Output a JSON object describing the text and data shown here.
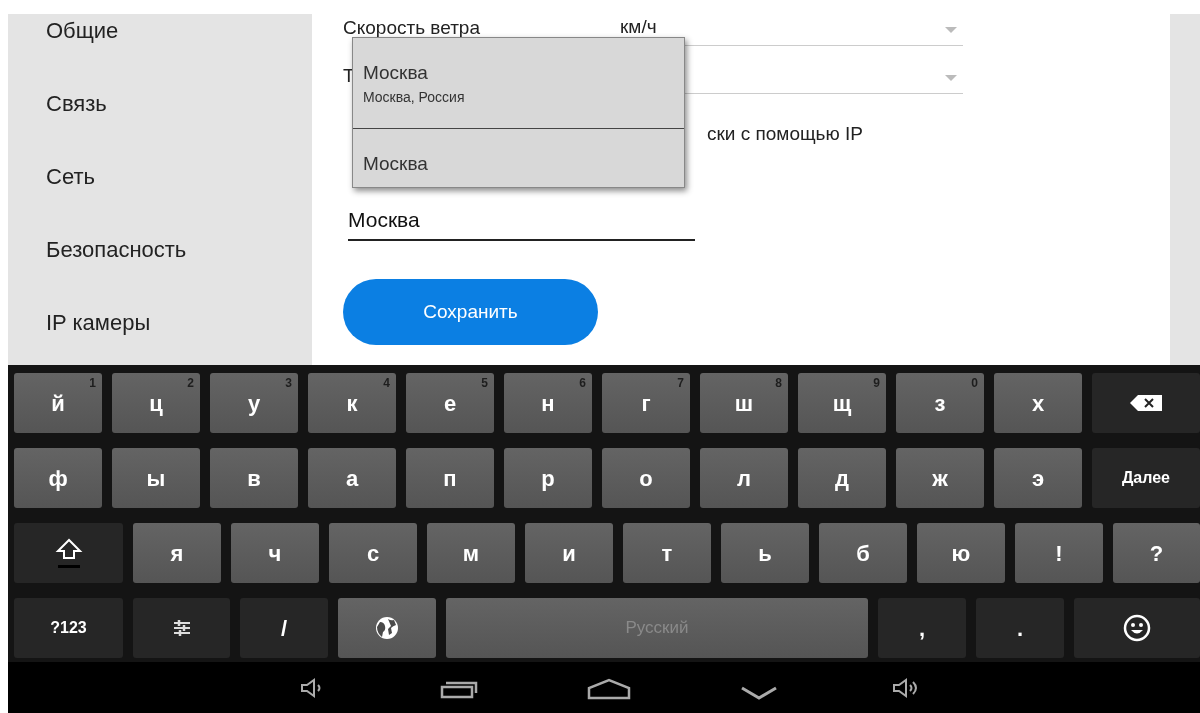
{
  "sidebar": {
    "items": [
      {
        "label": "Общие"
      },
      {
        "label": "Связь"
      },
      {
        "label": "Сеть"
      },
      {
        "label": "Безопасность"
      },
      {
        "label": "IP камеры"
      }
    ]
  },
  "form": {
    "rows": [
      {
        "label": "Скорость ветра",
        "value": "км/ч"
      },
      {
        "label": "Т"
      }
    ],
    "checkbox_label": "ски с помощью IP",
    "city_field": {
      "value": "Москва"
    },
    "save_button": "Сохранить"
  },
  "suggestions": [
    {
      "title": "Москва",
      "subtitle": "Москва, Россия"
    },
    {
      "title": "Москва"
    }
  ],
  "keyboard": {
    "rows": [
      {
        "keys": [
          {
            "kind": "letter",
            "label": "й",
            "hint": "1"
          },
          {
            "kind": "letter",
            "label": "ц",
            "hint": "2"
          },
          {
            "kind": "letter",
            "label": "у",
            "hint": "3"
          },
          {
            "kind": "letter",
            "label": "к",
            "hint": "4"
          },
          {
            "kind": "letter",
            "label": "е",
            "hint": "5"
          },
          {
            "kind": "letter",
            "label": "н",
            "hint": "6"
          },
          {
            "kind": "letter",
            "label": "г",
            "hint": "7"
          },
          {
            "kind": "letter",
            "label": "ш",
            "hint": "8"
          },
          {
            "kind": "letter",
            "label": "щ",
            "hint": "9"
          },
          {
            "kind": "letter",
            "label": "з",
            "hint": "0"
          },
          {
            "kind": "letter",
            "label": "х"
          },
          {
            "kind": "backspace"
          }
        ]
      },
      {
        "keys": [
          {
            "kind": "letter",
            "label": "ф"
          },
          {
            "kind": "letter",
            "label": "ы"
          },
          {
            "kind": "letter",
            "label": "в"
          },
          {
            "kind": "letter",
            "label": "а"
          },
          {
            "kind": "letter",
            "label": "п"
          },
          {
            "kind": "letter",
            "label": "р"
          },
          {
            "kind": "letter",
            "label": "о"
          },
          {
            "kind": "letter",
            "label": "л"
          },
          {
            "kind": "letter",
            "label": "д"
          },
          {
            "kind": "letter",
            "label": "ж"
          },
          {
            "kind": "letter",
            "label": "э"
          },
          {
            "kind": "enter",
            "label": "Далее"
          }
        ]
      },
      {
        "keys": [
          {
            "kind": "shift"
          },
          {
            "kind": "letter",
            "label": "я"
          },
          {
            "kind": "letter",
            "label": "ч"
          },
          {
            "kind": "letter",
            "label": "с"
          },
          {
            "kind": "letter",
            "label": "м"
          },
          {
            "kind": "letter",
            "label": "и"
          },
          {
            "kind": "letter",
            "label": "т"
          },
          {
            "kind": "letter",
            "label": "ь"
          },
          {
            "kind": "letter",
            "label": "б"
          },
          {
            "kind": "letter",
            "label": "ю"
          },
          {
            "kind": "letter",
            "label": "!"
          },
          {
            "kind": "letter",
            "label": "?"
          }
        ]
      },
      {
        "keys": [
          {
            "kind": "mode",
            "label": "?123"
          },
          {
            "kind": "settings"
          },
          {
            "kind": "dark",
            "label": "/"
          },
          {
            "kind": "globe"
          },
          {
            "kind": "space",
            "label": "Русский"
          },
          {
            "kind": "dark",
            "label": ","
          },
          {
            "kind": "dark",
            "label": "."
          },
          {
            "kind": "emoji"
          }
        ]
      }
    ]
  }
}
